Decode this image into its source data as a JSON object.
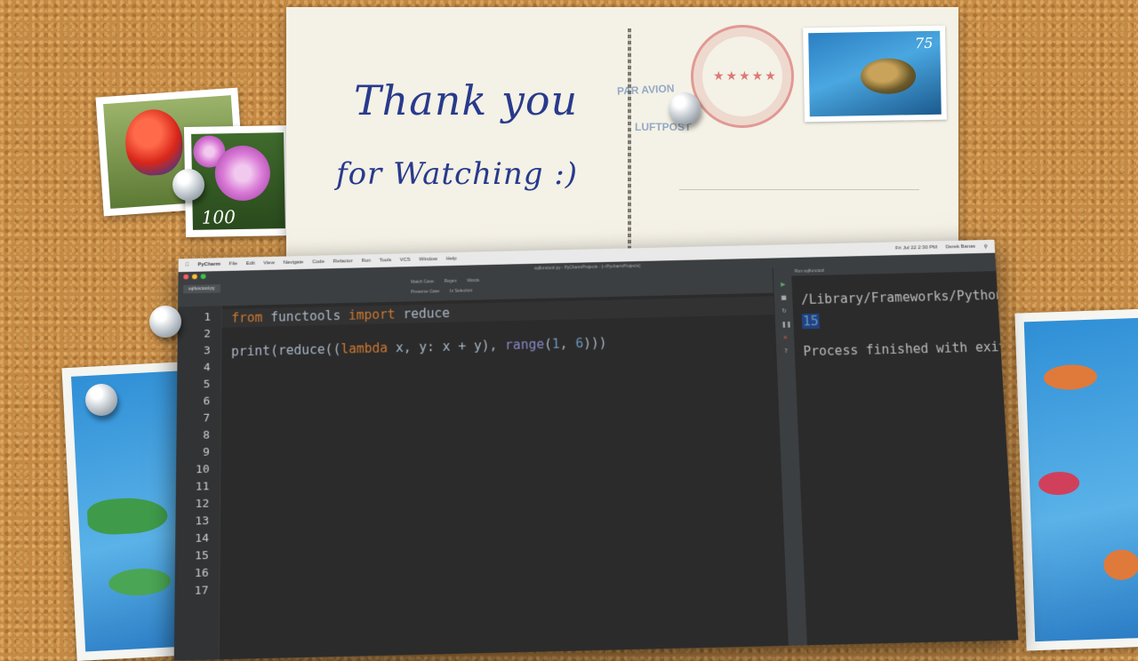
{
  "postcard": {
    "line1": "Thank you",
    "line2": "for Watching :)",
    "airmail_line1": "PAR AVION",
    "airmail_line2": "LUFTPOST",
    "postmark_stars": "★★★★★",
    "stamp_value": "75"
  },
  "stamps": {
    "flower_value": "100"
  },
  "ide": {
    "menubar": {
      "app": "PyCharm",
      "items": [
        "File",
        "Edit",
        "View",
        "Navigate",
        "Code",
        "Refactor",
        "Run",
        "Tools",
        "VCS",
        "Window",
        "Help"
      ],
      "clock": "Fri Jul 22 2:30 PM",
      "user": "Derek Banas"
    },
    "title": "sqlfunctool.py - PyCharmProjects - [~/PycharmProjects]",
    "tab": "sqlfunctool.py",
    "search_options": [
      "Match Case",
      "Regex",
      "Words"
    ],
    "search_options2": [
      "Preserve Case",
      "In Selection"
    ],
    "run_header": "Run  sqlfunctool",
    "code": [
      {
        "ln": "1"
      },
      {
        "ln": "2"
      },
      {
        "ln": "3"
      },
      {
        "ln": "4"
      },
      {
        "ln": "5"
      },
      {
        "ln": "6"
      },
      {
        "ln": "7"
      },
      {
        "ln": "8"
      },
      {
        "ln": "9"
      },
      {
        "ln": "10"
      },
      {
        "ln": "11"
      },
      {
        "ln": "12"
      },
      {
        "ln": "13"
      },
      {
        "ln": "14"
      },
      {
        "ln": "15"
      },
      {
        "ln": "16"
      },
      {
        "ln": "17"
      }
    ],
    "line1_tokens": {
      "from": "from",
      "module": " functools ",
      "import": "import",
      "name": " reduce"
    },
    "line3_tokens": {
      "p1": "print(reduce((",
      "lambda": "lambda",
      "p2": " x, y: x + y), ",
      "range": "range",
      "p3": "(",
      "n1": "1",
      "p4": ", ",
      "n2": "6",
      "p5": ")))"
    },
    "output": {
      "path": "/Library/Frameworks/Python",
      "result": "15",
      "finish": "Process finished with exit"
    }
  }
}
